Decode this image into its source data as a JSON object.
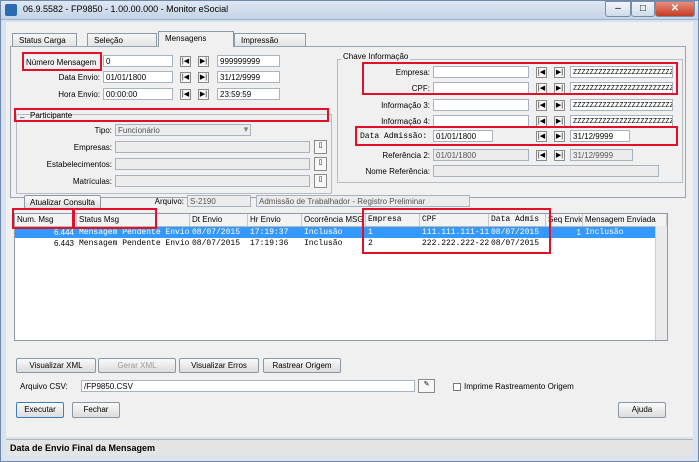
{
  "window": {
    "title": "06.9.5582 - FP9850 - 1.00.00.000 - Monitor eSocial"
  },
  "tabs": [
    "Status Carga",
    "Seleção",
    "Mensagens",
    "Impressão"
  ],
  "filters": {
    "numero_mensagem": {
      "label": "Número Mensagem",
      "from": "0",
      "to": "999999999"
    },
    "data_envio": {
      "label": "Data Envio:",
      "from": "01/01/1800",
      "to": "31/12/9999"
    },
    "hora_envio": {
      "label": "Hora Envio:",
      "from": "00:00:00",
      "to": "23:59:59"
    }
  },
  "participante": {
    "title": "Participante",
    "tipo_label": "Tipo:",
    "tipo_value": "Funcionário",
    "empresas_label": "Empresas:",
    "estabelecimentos_label": "Estabelecimentos:",
    "matriculas_label": "Matrículas:"
  },
  "chave": {
    "title": "Chave Informação",
    "empresa_label": "Empresa:",
    "cpf_label": "CPF:",
    "info3_label": "Informação 3:",
    "info4_label": "Informação 4:",
    "data_admissao_label": "Data Admissão:",
    "data_admissao_from": "01/01/1800",
    "data_admissao_to": "31/12/9999",
    "referencia2_label": "Referência 2:",
    "referencia2_from": "01/01/1800",
    "referencia2_to": "31/12/9999",
    "nome_referencia_label": "Nome Referência:",
    "mask": "ZZZZZZZZZZZZZZZZZZZZZZZZZZ"
  },
  "toolbar": {
    "atualizar": "Atualizar Consulta",
    "arquivo_label": "Arquivo:",
    "arquivo_code": "S-2190",
    "arquivo_desc": "Admissão de Trabalhador - Registro Preliminar"
  },
  "grid": {
    "headers": [
      "Num. Msg",
      "Status Msg",
      "Dt Envio",
      "Hr Envio",
      "Ocorrência MSG",
      "Empresa",
      "CPF",
      "Data Admis",
      "Seq Envio",
      "Mensagem Enviada"
    ],
    "rows": [
      [
        "6.444",
        "Mensagem Pendente Envio",
        "08/07/2015",
        "17:19:37",
        "Inclusão",
        "1",
        "111.111.111-11",
        "08/07/2015",
        "1",
        "Inclusão"
      ],
      [
        "6.443",
        "Mensagem Pendente Envio",
        "08/07/2015",
        "17:19:36",
        "Inclusão",
        "2",
        "222.222.222-22",
        "08/07/2015",
        "",
        ""
      ]
    ]
  },
  "actions": {
    "visualizar_xml": "Visualizar XML",
    "gerar_xml": "Gerar XML",
    "visualizar_erros": "Visualizar Erros",
    "rastrear_origem": "Rastrear Origem",
    "arquivo_csv_label": "Arquivo CSV:",
    "arquivo_csv_value": "/FP9850.CSV",
    "imprime_rastreamento": "Imprime Rastreamento Origem",
    "executar": "Executar",
    "fechar": "Fechar",
    "ajuda": "Ajuda"
  },
  "status": "Data de Envio Final da Mensagem"
}
